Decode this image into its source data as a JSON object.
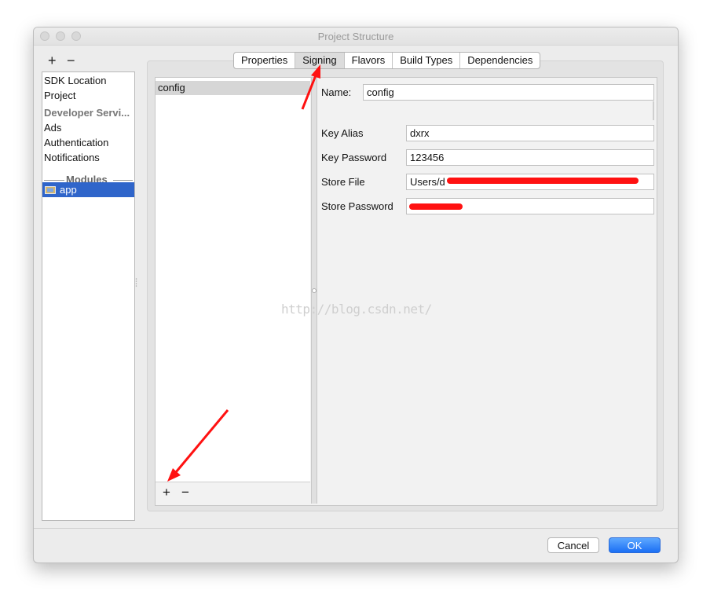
{
  "window": {
    "title": "Project Structure"
  },
  "toolbar": {
    "add_label": "+",
    "remove_label": "−"
  },
  "sidebar": {
    "items": [
      {
        "label": "SDK Location"
      },
      {
        "label": "Project"
      },
      {
        "label": "Developer Servi..."
      },
      {
        "label": "Ads"
      },
      {
        "label": "Authentication"
      },
      {
        "label": "Notifications"
      }
    ],
    "modules_header": "Modules",
    "selected_module": "app"
  },
  "tabs": [
    {
      "label": "Properties"
    },
    {
      "label": "Signing",
      "active": true
    },
    {
      "label": "Flavors"
    },
    {
      "label": "Build Types"
    },
    {
      "label": "Dependencies"
    }
  ],
  "signing": {
    "configs": [
      "config"
    ],
    "add_label": "+",
    "remove_label": "−",
    "name_label": "Name:",
    "name_value": "config",
    "key_alias_label": "Key Alias",
    "key_alias_value": "dxrx",
    "key_password_label": "Key Password",
    "key_password_value": "123456",
    "store_file_label": "Store File",
    "store_file_value": "Users/d                                                                                  o/R:",
    "store_password_label": "Store Password",
    "store_password_value": ""
  },
  "watermark": "http://blog.csdn.net/",
  "footer": {
    "cancel_label": "Cancel",
    "ok_label": "OK"
  },
  "colors": {
    "selection": "#2f65ca",
    "ok_button": "#1b6ff4",
    "annotation": "#ff1111"
  }
}
